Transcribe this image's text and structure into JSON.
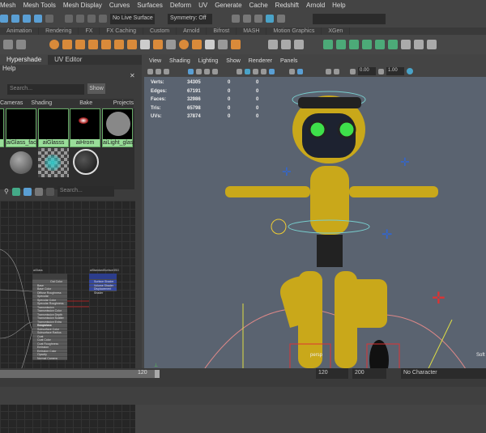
{
  "menu": [
    "Mesh",
    "Mesh Tools",
    "Mesh Display",
    "Curves",
    "Surfaces",
    "Deform",
    "UV",
    "Generate",
    "Cache",
    "Redshift",
    "Arnold",
    "Help"
  ],
  "status": {
    "live_surface": "No Live Surface",
    "symmetry": "Symmetry: Off"
  },
  "shelf_tabs": [
    "Animation",
    "Rendering",
    "FX",
    "FX Caching",
    "Custom",
    "Arnold",
    "Bifrost",
    "MASH",
    "Motion Graphics",
    "XGen"
  ],
  "panel_tabs": [
    "Hypershade",
    "UV Editor"
  ],
  "hypershade": {
    "menu": "Help",
    "search_placeholder": "Search...",
    "show_button": "Show",
    "tabs": [
      "Cameras",
      "Shading Groups",
      "Bake Sets",
      "Projects"
    ],
    "swatches": [
      "k",
      "aiGlass_face",
      "aiGlasss",
      "aiHrom",
      "aiLight_glass"
    ],
    "graph_search_placeholder": "Search...",
    "node1": {
      "title": "aiGlass",
      "output": "Out Color",
      "attrs": [
        "Base",
        "Base Color",
        "Diffuse Roughness",
        "Specular",
        "Specular Color",
        "Specular Roughness",
        "Transmission",
        "Transmission Color",
        "Transmission Depth",
        "Transmission Scatter",
        "Transmission Extra Roughness",
        "Subsurface",
        "Subsurface Color",
        "Subsurface Radius",
        "Coat",
        "Coat Color",
        "Coat Roughness",
        "Emission",
        "Emission Color",
        "Opacity",
        "Normal Camera"
      ]
    },
    "node2": {
      "title": "aiStandardSurface3SG",
      "attrs": [
        "Surface Shader",
        "Volume Shader",
        "Displacement Shader"
      ]
    }
  },
  "viewport": {
    "menu": [
      "View",
      "Shading",
      "Lighting",
      "Show",
      "Renderer",
      "Panels"
    ],
    "exposure": "0.00",
    "gamma": "1.00",
    "stats": [
      {
        "label": "Verts:",
        "v": "34305",
        "a": "0",
        "b": "0"
      },
      {
        "label": "Edges:",
        "v": "67191",
        "a": "0",
        "b": "0"
      },
      {
        "label": "Faces:",
        "v": "32986",
        "a": "0",
        "b": "0"
      },
      {
        "label": "Tris:",
        "v": "65798",
        "a": "0",
        "b": "0"
      },
      {
        "label": "UVs:",
        "v": "37874",
        "a": "0",
        "b": "0"
      }
    ],
    "camera": "persp",
    "soft": "Soft"
  },
  "timeline": {
    "range_end": "120",
    "end_field": "120",
    "max_field": "200",
    "character": "No Character"
  },
  "colors": {
    "accent": "#5a9fd4",
    "robot": "#d9b81e",
    "eyes": "#3ee04a"
  }
}
